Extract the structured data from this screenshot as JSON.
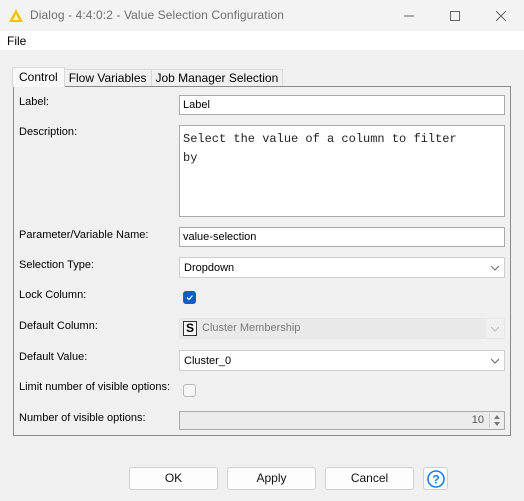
{
  "window": {
    "title": "Dialog - 4:4:0:2 - Value Selection Configuration",
    "icon": "knime-warning-triangle-icon",
    "controls": [
      "minimize",
      "maximize",
      "close"
    ]
  },
  "menubar": {
    "items": [
      {
        "label": "File"
      }
    ]
  },
  "tabs": [
    {
      "label": "Control",
      "active": true
    },
    {
      "label": "Flow Variables",
      "active": false
    },
    {
      "label": "Job Manager Selection",
      "active": false
    }
  ],
  "form": {
    "label": {
      "label": "Label:",
      "value": "Label"
    },
    "description": {
      "label": "Description:",
      "value": "Select the value of a column to filter\nby"
    },
    "parameter_name": {
      "label": "Parameter/Variable Name:",
      "value": "value-selection"
    },
    "selection_type": {
      "label": "Selection Type:",
      "value": "Dropdown"
    },
    "lock_column": {
      "label": "Lock Column:",
      "checked": true
    },
    "default_column": {
      "label": "Default Column:",
      "type_badge": "S",
      "value": "Cluster Membership",
      "enabled": false
    },
    "default_value": {
      "label": "Default Value:",
      "value": "Cluster_0"
    },
    "limit_visible": {
      "label": "Limit number of visible options:",
      "checked": false
    },
    "visible_options": {
      "label": "Number of visible options:",
      "value": "10",
      "enabled": false
    }
  },
  "buttons": {
    "ok": "OK",
    "apply": "Apply",
    "cancel": "Cancel",
    "help_icon": "help-circle-icon"
  },
  "colors": {
    "accent": "#0a5fc2",
    "help": "#1a7fe0",
    "title_icon": "#f5c400"
  }
}
